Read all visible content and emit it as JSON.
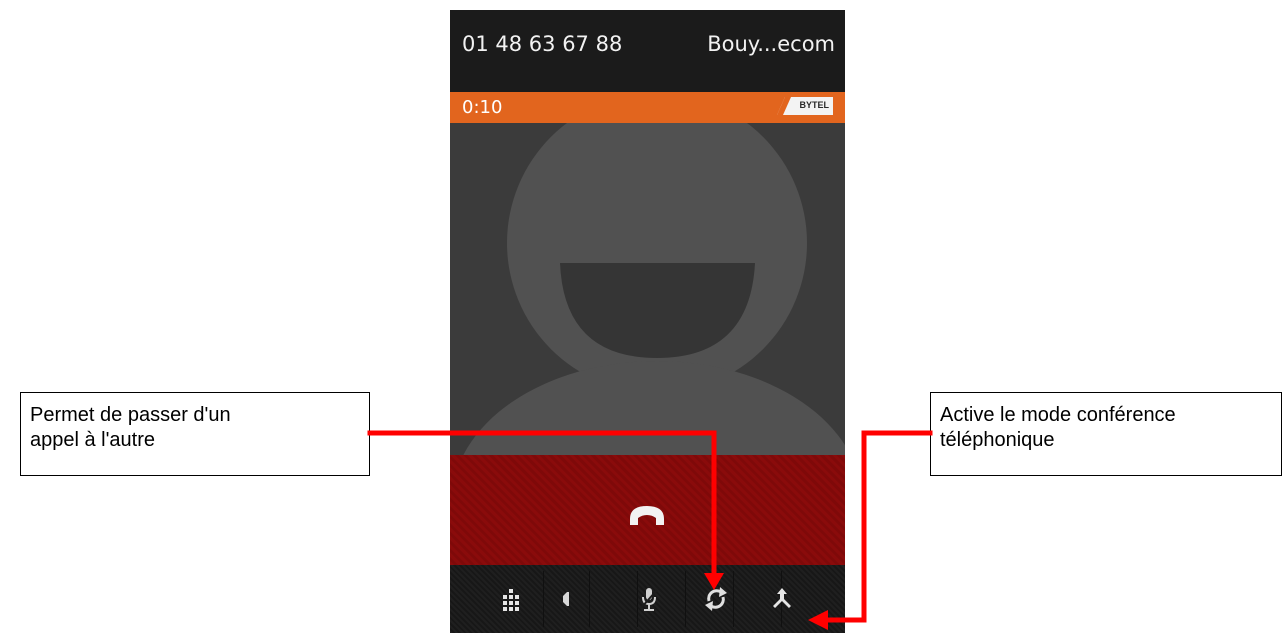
{
  "call": {
    "number": "01 48 63 67 88",
    "operator": "Bouy...ecom",
    "timer": "0:10",
    "badge": "BYTEL"
  },
  "toolbar": {
    "buttons": [
      {
        "name": "dialpad",
        "icon": "dialpad-icon"
      },
      {
        "name": "speaker",
        "icon": "speaker-icon"
      },
      {
        "name": "mute",
        "icon": "mic-icon"
      },
      {
        "name": "swap",
        "icon": "swap-calls-icon"
      },
      {
        "name": "merge",
        "icon": "merge-calls-icon"
      }
    ]
  },
  "annotations": {
    "left": {
      "line1": "Permet de passer d'un",
      "line2": "appel à l'autre"
    },
    "right": {
      "line1": "Active le mode conférence",
      "line2": "téléphonique"
    }
  },
  "colors": {
    "status_bar": "#e2651e",
    "end_call_area": "#8a0b0b",
    "arrow": "#ff0000",
    "header": "#1b1b1b"
  }
}
